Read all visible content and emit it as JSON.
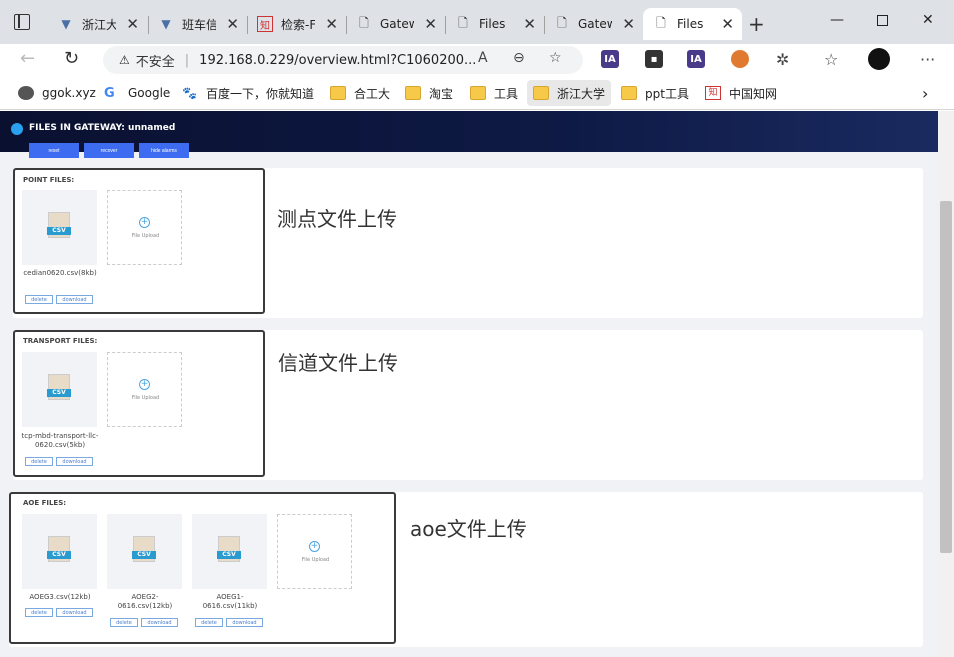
{
  "tabs": [
    {
      "title": "浙江大"
    },
    {
      "title": "班车信"
    },
    {
      "title": "检索-F"
    },
    {
      "title": "Gatew"
    },
    {
      "title": "Files"
    },
    {
      "title": "Gatew"
    },
    {
      "title": "Files"
    }
  ],
  "address": {
    "insecure_label": "不安全",
    "url": "192.168.0.229/overview.html?C1060200..."
  },
  "extensions": [
    "IA",
    "IA"
  ],
  "bookmarks": [
    "ggok.xyz",
    "Google",
    "百度一下，你就知道",
    "合工大",
    "淘宝",
    "工具",
    "浙江大学",
    "ppt工具",
    "中国知网"
  ],
  "page": {
    "title": "FILES IN GATEWAY: unnamed",
    "buttons": [
      "reset",
      "recover",
      "hide alarms"
    ],
    "sections": [
      {
        "label": "POINT FILES:",
        "note": "测点文件上传",
        "files": [
          {
            "name": "cedian0620.csv(8kb)",
            "delete": "delete",
            "download": "download"
          }
        ],
        "upload": "File Upload"
      },
      {
        "label": "TRANSPORT FILES:",
        "note": "信道文件上传",
        "files": [
          {
            "name": "tcp-mbd-transport-llc-0620.csv(5kb)",
            "delete": "delete",
            "download": "download"
          }
        ],
        "upload": "File Upload"
      },
      {
        "label": "AOE FILES:",
        "note": "aoe文件上传",
        "files": [
          {
            "name": "AOEG3.csv(12kb)",
            "delete": "delete",
            "download": "download"
          },
          {
            "name": "AOEG2-0616.csv(12kb)",
            "delete": "delete",
            "download": "download"
          },
          {
            "name": "AOEG1-0616.csv(11kb)",
            "delete": "delete",
            "download": "download"
          }
        ],
        "upload": "File Upload"
      }
    ],
    "csv_label": "CSV"
  }
}
